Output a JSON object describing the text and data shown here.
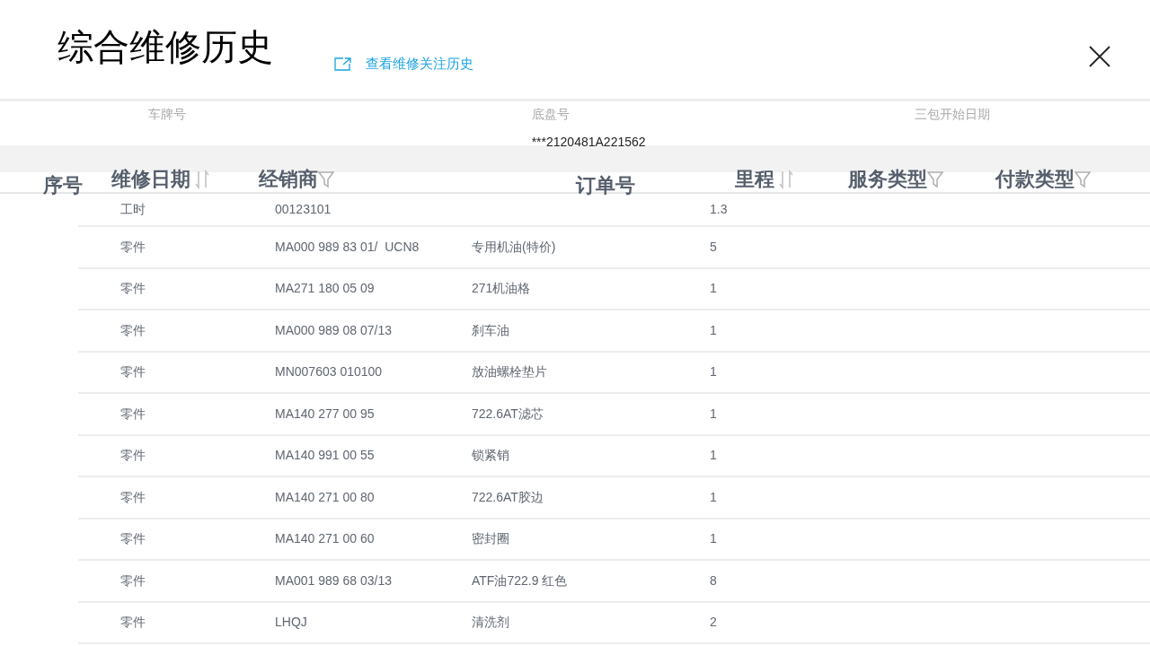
{
  "title": "综合维修历史",
  "link": "查看维修关注历史",
  "info": [
    {
      "label": "车牌号"
    },
    {
      "label": "底盘号",
      "value": "***2120481A221562"
    },
    {
      "label": "三包开始日期"
    }
  ],
  "columns": [
    {
      "label": "序号",
      "kind": "plain"
    },
    {
      "label": "维修日期",
      "kind": "sort"
    },
    {
      "label": "经销商",
      "kind": "filter"
    },
    {
      "label": "订单号",
      "kind": "plain"
    },
    {
      "label": "里程",
      "kind": "sort"
    },
    {
      "label": "服务类型",
      "kind": "filter"
    },
    {
      "label": "付款类型",
      "kind": "filter"
    }
  ],
  "rows": [
    [
      "工时",
      "00123101",
      "",
      "1.3"
    ],
    [
      "零件",
      "MA000 989 83 01/  UCN8",
      "专用机油(特价)",
      "5"
    ],
    [
      "零件",
      "MA271 180 05 09",
      "271机油格",
      "1"
    ],
    [
      "零件",
      "MA000 989 08 07/13",
      "刹车油",
      "1"
    ],
    [
      "零件",
      "MN007603 010100",
      "放油螺栓垫片",
      "1"
    ],
    [
      "零件",
      "MA140 277 00 95",
      "722.6AT滤芯",
      "1"
    ],
    [
      "零件",
      "MA140 991 00 55",
      "锁紧销",
      "1"
    ],
    [
      "零件",
      "MA140 271 00 80",
      "722.6AT胶边",
      "1"
    ],
    [
      "零件",
      "MA140 271 00 60",
      "密封圈",
      "1"
    ],
    [
      "零件",
      "MA001 989 68 03/13",
      "ATF油722.9 红色",
      "8"
    ],
    [
      "零件",
      "LHQJ",
      "清洗剂",
      "2"
    ]
  ]
}
